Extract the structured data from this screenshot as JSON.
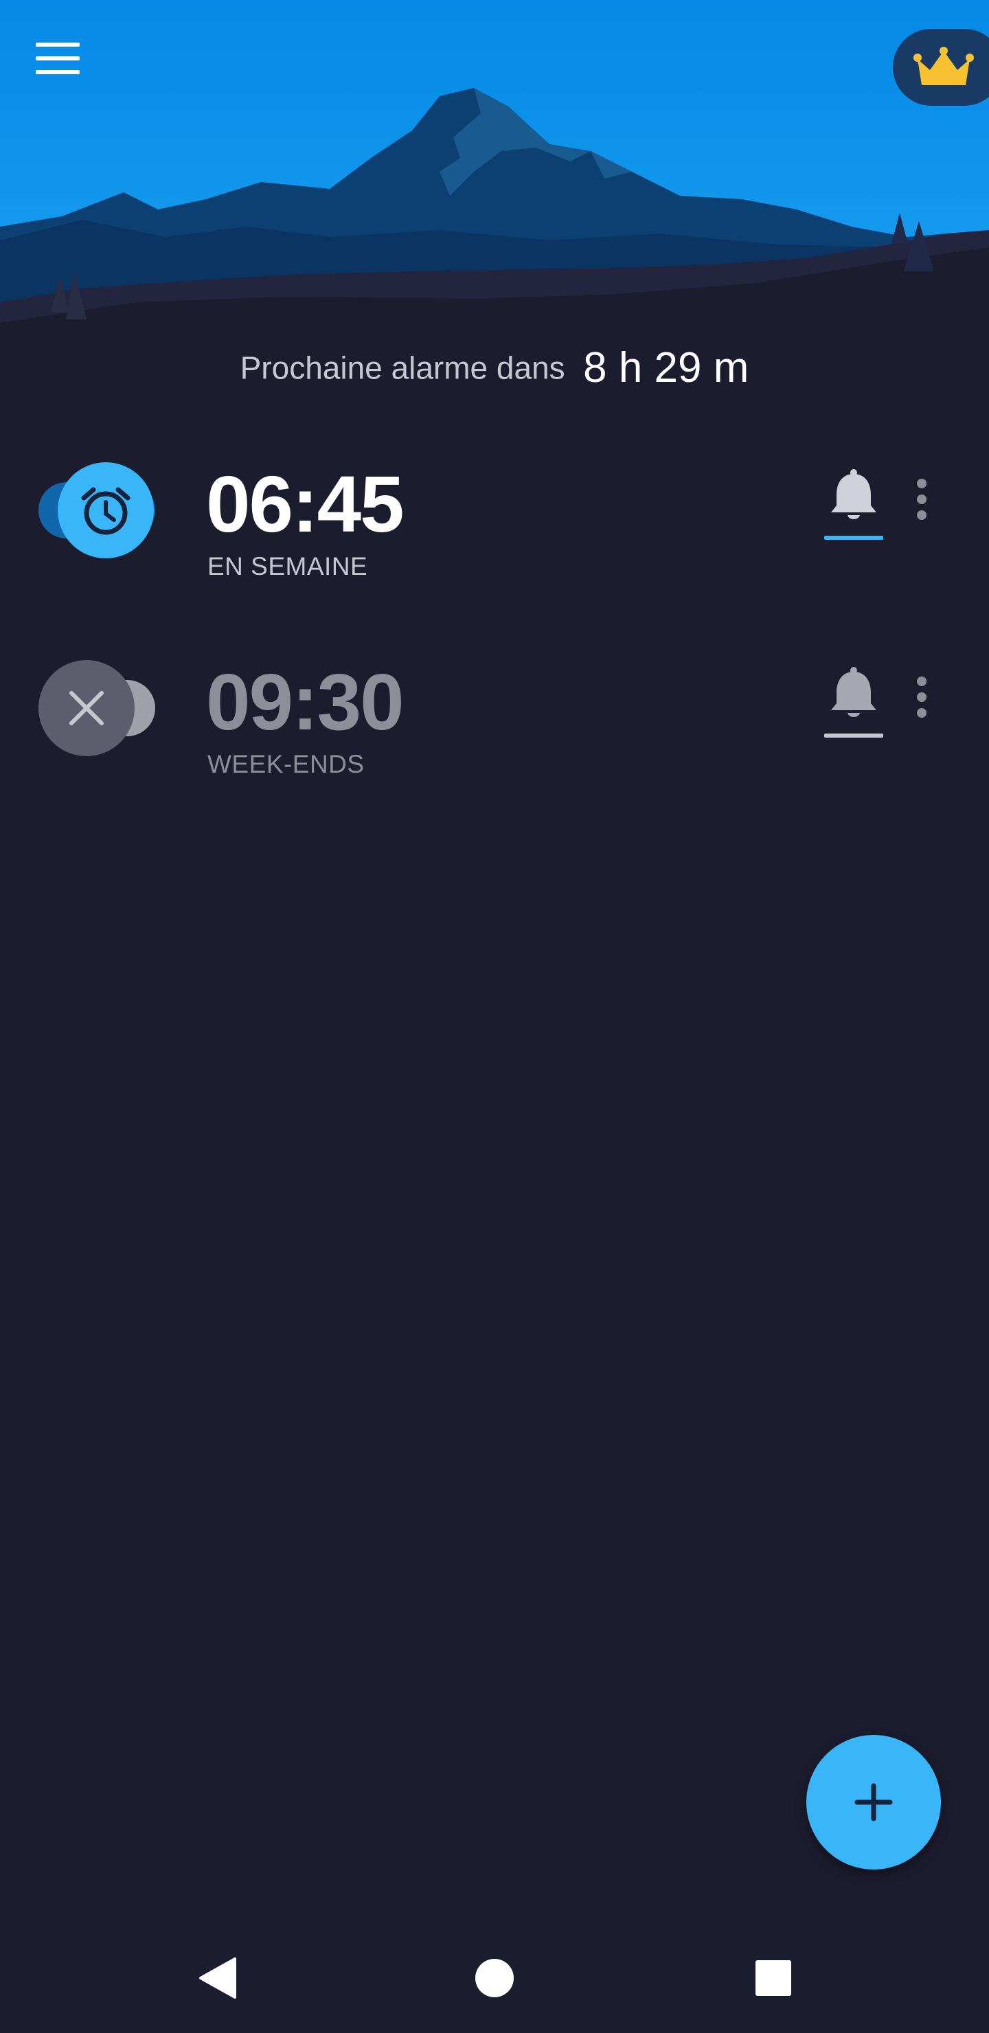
{
  "header": {
    "menu_icon": "hamburger-menu-icon",
    "premium_icon": "crown-icon",
    "premium_color": "#f7c22f"
  },
  "next_alarm": {
    "label": "Prochaine alarme dans",
    "value": "8 h 29 m"
  },
  "alarms": [
    {
      "time": "06:45",
      "repeat": "EN SEMAINE",
      "enabled": true,
      "toggle_icon": "alarm-clock-icon",
      "bell_icon": "bell-icon",
      "more_icon": "more-vertical-icon"
    },
    {
      "time": "09:30",
      "repeat": "WEEK-ENDS",
      "enabled": false,
      "toggle_icon": "close-icon",
      "bell_icon": "bell-icon",
      "more_icon": "more-vertical-icon"
    }
  ],
  "fab": {
    "icon": "plus-icon"
  },
  "navigation": {
    "back_icon": "back-triangle-icon",
    "home_icon": "home-circle-icon",
    "recents_icon": "recents-square-icon"
  },
  "colors": {
    "background": "#1c1c2f",
    "accent": "#38b6f8",
    "sky_top": "#0489e6",
    "text_active": "#ffffff",
    "text_inactive": "#8e8e9a"
  }
}
